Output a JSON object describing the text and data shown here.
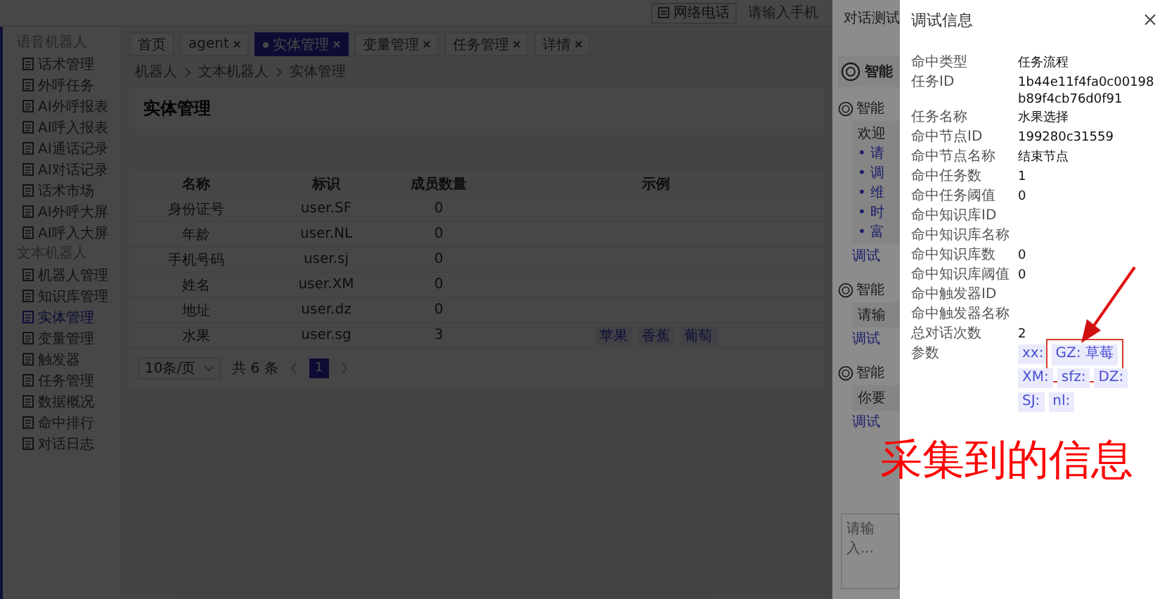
{
  "top_bar": {
    "phone_button": "网络电话",
    "phone_field": {
      "placeholder": "请输入手机"
    }
  },
  "sidebar": {
    "groups": [
      {
        "label": "语音机器人",
        "items": [
          {
            "label": "话术管理",
            "selected": false
          },
          {
            "label": "外呼任务",
            "selected": false
          },
          {
            "label": "AI外呼报表",
            "selected": false
          },
          {
            "label": "AI呼入报表",
            "selected": false
          },
          {
            "label": "AI通话记录",
            "selected": false
          },
          {
            "label": "AI对话记录",
            "selected": false
          },
          {
            "label": "话术市场",
            "selected": false
          },
          {
            "label": "AI外呼大屏",
            "selected": false
          },
          {
            "label": "AI呼入大屏",
            "selected": false
          }
        ]
      },
      {
        "label": "文本机器人",
        "items": [
          {
            "label": "机器人管理",
            "selected": false
          },
          {
            "label": "知识库管理",
            "selected": false
          },
          {
            "label": "实体管理",
            "selected": true
          },
          {
            "label": "变量管理",
            "selected": false
          },
          {
            "label": "触发器",
            "selected": false
          },
          {
            "label": "任务管理",
            "selected": false
          },
          {
            "label": "数据概况",
            "selected": false
          },
          {
            "label": "命中排行",
            "selected": false
          },
          {
            "label": "对话日志",
            "selected": false
          }
        ]
      }
    ]
  },
  "tabs": [
    {
      "label": "首页",
      "closable": false,
      "selected": false
    },
    {
      "label": "agent",
      "closable": true,
      "selected": false
    },
    {
      "label": "实体管理",
      "closable": true,
      "selected": true
    },
    {
      "label": "变量管理",
      "closable": true,
      "selected": false
    },
    {
      "label": "任务管理",
      "closable": true,
      "selected": false
    },
    {
      "label": "详情",
      "closable": true,
      "selected": false
    }
  ],
  "breadcrumb": [
    "机器人",
    "文本机器人",
    "实体管理"
  ],
  "page_title": "实体管理",
  "table": {
    "columns": [
      "名称",
      "标识",
      "成员数量",
      "示例"
    ],
    "rows": [
      {
        "cells": [
          "身份证号",
          "user.SF",
          "0"
        ]
      },
      {
        "cells": [
          "年龄",
          "user.NL",
          "0"
        ]
      },
      {
        "cells": [
          "手机号码",
          "user.sj",
          "0"
        ]
      },
      {
        "cells": [
          "姓名",
          "user.XM",
          "0"
        ]
      },
      {
        "cells": [
          "地址",
          "user.dz",
          "0"
        ]
      },
      {
        "cells": [
          "水果",
          "user.sg",
          "3"
        ],
        "examples": [
          "苹果",
          "香蕉",
          "葡萄"
        ]
      }
    ]
  },
  "pagination": {
    "page_size": "10条/页",
    "total": "共 6 条",
    "pages": [
      {
        "label": "1",
        "selected": true
      }
    ]
  },
  "chat_drawer": {
    "title": "对话测试",
    "header": "智能",
    "messages": [
      {
        "sender": "智能",
        "text": "欢迎",
        "bullets": [
          "• 请",
          "• 调",
          "• 维",
          "• 时",
          "• 富"
        ],
        "link": "调试"
      },
      {
        "sender": "智能",
        "text": "请输",
        "link": "调试"
      },
      {
        "sender": "智能",
        "text": "你要",
        "link": "调试"
      }
    ],
    "input": {
      "placeholder": "请输入..."
    }
  },
  "debug_drawer": {
    "title": "调试信息",
    "fields": [
      {
        "label": "命中类型",
        "value": "任务流程"
      },
      {
        "label": "任务ID",
        "value": "1b44e11f4fa0c00198b89f4cb76d0f91"
      },
      {
        "label": "任务名称",
        "value": "水果选择"
      },
      {
        "label": "命中节点ID",
        "value": "199280c31559"
      },
      {
        "label": "命中节点名称",
        "value": "结束节点"
      },
      {
        "label": "命中任务数",
        "value": "1"
      },
      {
        "label": "命中任务阈值",
        "value": "0"
      },
      {
        "label": "命中知识库ID"
      },
      {
        "label": "命中知识库名称"
      },
      {
        "label": "命中知识库数",
        "value": "0"
      },
      {
        "label": "命中知识库阈值",
        "value": "0"
      },
      {
        "label": "命中触发器ID"
      },
      {
        "label": "命中触发器名称"
      },
      {
        "label": "总对话次数",
        "value": "2"
      }
    ],
    "params": {
      "label": "参数",
      "tags": [
        {
          "text": "xx:",
          "highlighted": false
        },
        {
          "text": "GZ: 草莓",
          "highlighted": true
        },
        {
          "text": "XM:",
          "highlighted": false
        },
        {
          "text": "sfz:",
          "highlighted": false
        },
        {
          "text": "DZ:",
          "highlighted": false
        },
        {
          "text": "SJ:",
          "highlighted": false
        },
        {
          "text": "nl:",
          "highlighted": false
        }
      ]
    }
  },
  "annotation": {
    "text": "采集到的信息"
  }
}
